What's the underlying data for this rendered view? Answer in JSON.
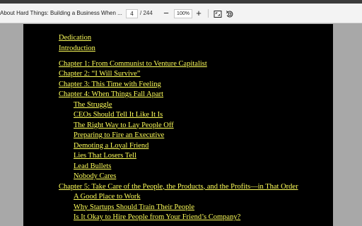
{
  "toolbar": {
    "document_title": "About Hard Things: Building a Business When ...",
    "page_current": "4",
    "page_total": "/ 244",
    "zoom_out": "−",
    "zoom_value": "100%",
    "zoom_in": "+",
    "icons": {
      "fit": "fit-page-icon",
      "rotate": "rotate-icon"
    }
  },
  "colors": {
    "page_background": "#000000",
    "link": "#ffff5a",
    "viewer_background": "#a8a8a8",
    "toolbar": "#f3f3f3"
  },
  "toc": {
    "dedication": "Dedication",
    "introduction": "Introduction",
    "ch1": "Chapter 1: From Communist to Venture Capitalist",
    "ch2": "Chapter 2: “I Will Survive”",
    "ch3": "Chapter 3: This Time with Feeling",
    "ch4": "Chapter 4: When Things Fall Apart",
    "ch4_sections": [
      "The Struggle",
      "CEOs Should Tell It Like It Is",
      "The Right Way to Lay People Off",
      "Preparing to Fire an Executive",
      "Demoting a Loyal Friend",
      "Lies That Losers Tell",
      "Lead Bullets",
      "Nobody Cares"
    ],
    "ch5": "Chapter 5: Take Care of the People, the Products, and the Profits—in That Order",
    "ch5_sections": [
      "A Good Place to Work",
      "Why Startups Should Train Their People",
      "Is It Okay to Hire People from Your Friend’s Company?"
    ]
  }
}
